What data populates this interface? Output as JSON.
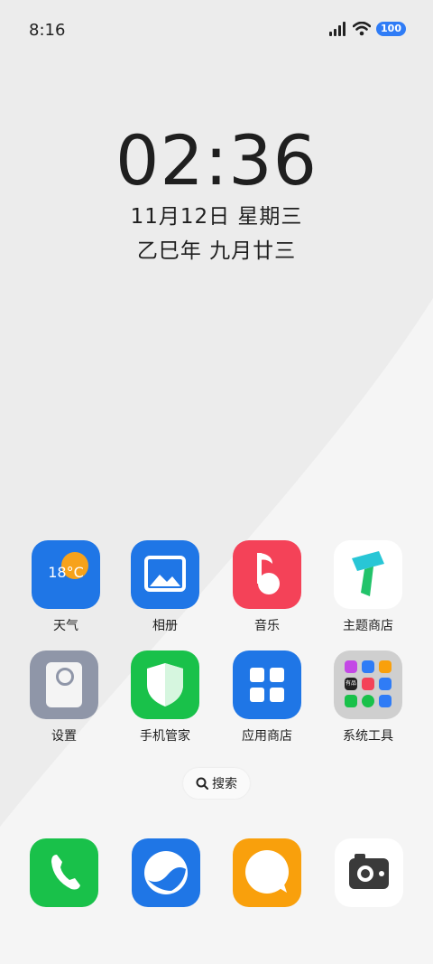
{
  "status_bar": {
    "time": "8:16",
    "battery": "100",
    "icons": [
      "signal-icon",
      "wifi-icon",
      "battery-icon"
    ]
  },
  "clock": {
    "time": "02:36",
    "date": "11月12日 星期三",
    "lunar": "乙巳年 九月廿三"
  },
  "apps": [
    {
      "label": "天气",
      "icon": "weather-icon",
      "temperature": "18°C",
      "color": "#1f76e6"
    },
    {
      "label": "相册",
      "icon": "gallery-icon",
      "color": "#1f76e6"
    },
    {
      "label": "音乐",
      "icon": "music-icon",
      "color": "#f44258"
    },
    {
      "label": "主题商店",
      "icon": "theme-store-icon",
      "color": "#ffffff"
    },
    {
      "label": "设置",
      "icon": "settings-icon",
      "color": "#8f96a8"
    },
    {
      "label": "手机管家",
      "icon": "phone-manager-icon",
      "color": "#19c14a"
    },
    {
      "label": "应用商店",
      "icon": "app-store-icon",
      "color": "#1f76e6"
    },
    {
      "label": "系统工具",
      "icon": "system-tools-folder-icon",
      "color": "#cfcfcf",
      "mini_label": "有品"
    }
  ],
  "search": {
    "label": "搜索",
    "icon": "search-icon"
  },
  "dock": [
    {
      "name": "phone",
      "icon": "phone-icon",
      "color": "#19c14a"
    },
    {
      "name": "browser",
      "icon": "browser-icon",
      "color": "#1f76e6"
    },
    {
      "name": "messages",
      "icon": "message-icon",
      "color": "#f9a00c"
    },
    {
      "name": "camera",
      "icon": "camera-icon",
      "color": "#ffffff"
    }
  ]
}
